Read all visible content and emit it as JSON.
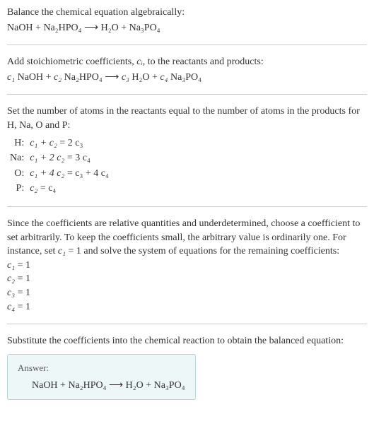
{
  "section1": {
    "title": "Balance the chemical equation algebraically:",
    "equation": "NaOH + Na₂HPO₄ ⟶ H₂O + Na₃PO₄"
  },
  "section2": {
    "intro_before": "Add stoichiometric coefficients, ",
    "intro_ci": "cᵢ",
    "intro_after": ", to the reactants and products:",
    "equation_c1": "c₁",
    "equation_r1": " NaOH + ",
    "equation_c2": "c₂",
    "equation_r2": " Na₂HPO₄ ⟶ ",
    "equation_c3": "c₃",
    "equation_r3": " H₂O + ",
    "equation_c4": "c₄",
    "equation_r4": " Na₃PO₄"
  },
  "section3": {
    "intro": "Set the number of atoms in the reactants equal to the number of atoms in the products for H, Na, O and P:",
    "rows": [
      {
        "el": "H:",
        "eq_l": "c₁ + c₂",
        "eq_r": " = 2 c₃"
      },
      {
        "el": "Na:",
        "eq_l": "c₁ + 2 c₂",
        "eq_r": " = 3 c₄"
      },
      {
        "el": "O:",
        "eq_l": "c₁ + 4 c₂",
        "eq_r": " = c₃ + 4 c₄"
      },
      {
        "el": "P:",
        "eq_l": "c₂",
        "eq_r": " = c₄"
      }
    ]
  },
  "section4": {
    "intro_a": "Since the coefficients are relative quantities and underdetermined, choose a coefficient to set arbitrarily. To keep the coefficients small, the arbitrary value is ordinarily one. For instance, set ",
    "intro_c1": "c₁",
    "intro_b": " = 1 and solve the system of equations for the remaining coefficients:",
    "coefs": [
      {
        "c": "c₁",
        "v": " = 1"
      },
      {
        "c": "c₂",
        "v": " = 1"
      },
      {
        "c": "c₃",
        "v": " = 1"
      },
      {
        "c": "c₄",
        "v": " = 1"
      }
    ]
  },
  "section5": {
    "intro": "Substitute the coefficients into the chemical reaction to obtain the balanced equation:",
    "answer_label": "Answer:",
    "answer_equation": "NaOH + Na₂HPO₄ ⟶ H₂O + Na₃PO₄"
  }
}
